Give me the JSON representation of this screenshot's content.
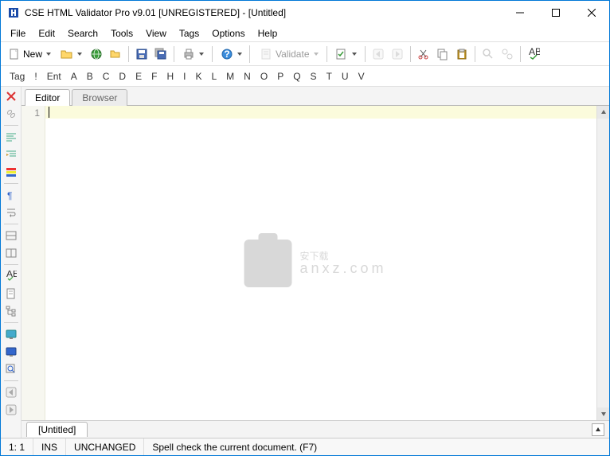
{
  "window": {
    "title": "CSE HTML Validator Pro v9.01 [UNREGISTERED] - [Untitled]"
  },
  "menu": {
    "items": [
      "File",
      "Edit",
      "Search",
      "Tools",
      "View",
      "Tags",
      "Options",
      "Help"
    ]
  },
  "toolbar": {
    "new_label": "New",
    "validate_label": "Validate"
  },
  "tagbar": {
    "items": [
      "Tag",
      "!",
      "Ent",
      "A",
      "B",
      "C",
      "D",
      "E",
      "F",
      "H",
      "I",
      "K",
      "L",
      "M",
      "N",
      "O",
      "P",
      "Q",
      "S",
      "T",
      "U",
      "V"
    ]
  },
  "tabs": {
    "editor": "Editor",
    "browser": "Browser"
  },
  "editor": {
    "line1": "1"
  },
  "doc_tab": {
    "label": "[Untitled]"
  },
  "status": {
    "pos": "1: 1",
    "ins": "INS",
    "changed": "UNCHANGED",
    "hint": "Spell check the current document. (F7)"
  },
  "watermark": {
    "main": "安下载",
    "sub": "anxz.com"
  }
}
